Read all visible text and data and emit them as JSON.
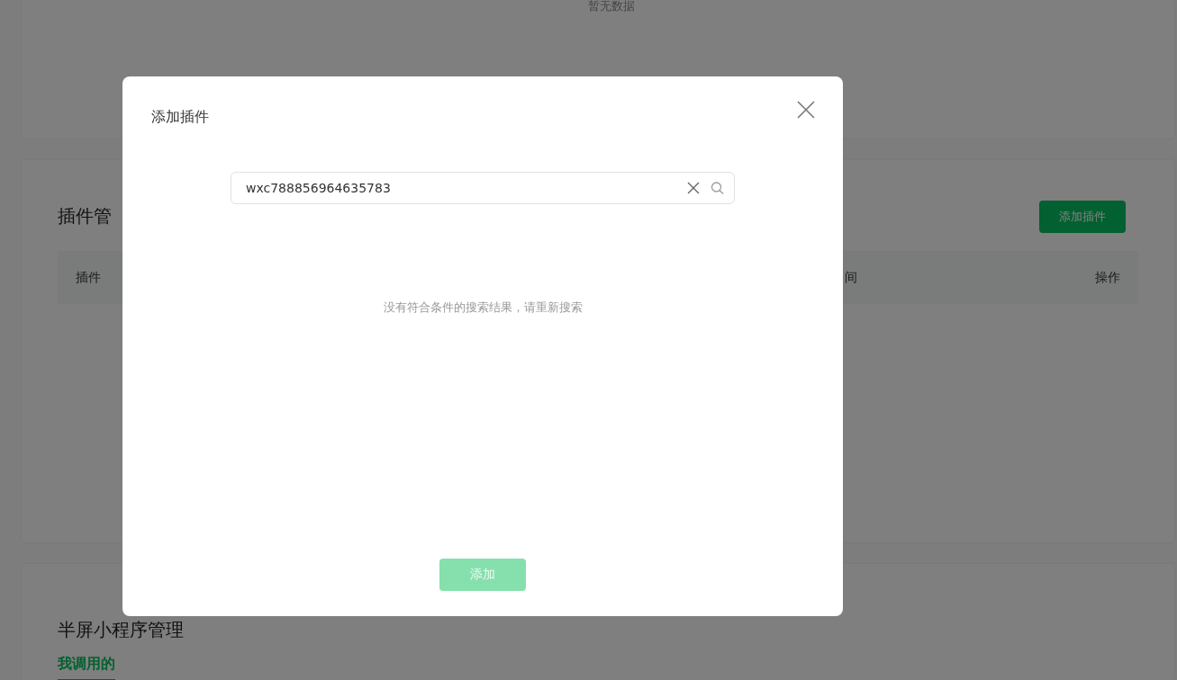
{
  "background": {
    "top_card": {
      "empty_text": "暂无数据"
    },
    "plugin_section": {
      "title": "插件管",
      "add_button": "添加插件",
      "table": {
        "columns": [
          "插件",
          "间",
          "操作"
        ]
      }
    },
    "half_screen_section": {
      "title": "半屏小程序管理",
      "tabs": [
        {
          "label": "我调用的",
          "selected": true
        }
      ]
    }
  },
  "dialog": {
    "title": "添加插件",
    "search": {
      "value": "wxc788856964635783"
    },
    "empty_message": "没有符合条件的搜索结果，请重新搜索",
    "add_button": {
      "label": "添加",
      "disabled": true
    }
  }
}
